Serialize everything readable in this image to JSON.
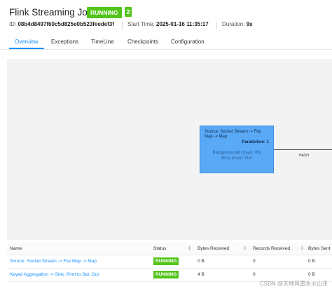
{
  "job": {
    "title": "Flink Streaming Job",
    "status": "RUNNING",
    "count": "2",
    "id_label": "ID:",
    "id_value": "08b4d8497f60c5d825e0b523feedef3f",
    "start_label": "Start Time:",
    "start_value": "2025-01-16 11:35:17",
    "duration_label": "Duration:",
    "duration_value": "9s"
  },
  "tabs": [
    "Overview",
    "Exceptions",
    "TimeLine",
    "Checkpoints",
    "Configuration"
  ],
  "active_tab": "Overview",
  "graph": {
    "node": {
      "name": "Source: Socket Stream -> Flat Map -> Map",
      "parallelism": "Parallelism: 1",
      "backpressured": "Backpressured (max): 0%",
      "busy": "Busy (max): N/A"
    },
    "edge_label": "HASH"
  },
  "table": {
    "more_indicator": "...",
    "headers": [
      "Name",
      "Status",
      "Bytes Received",
      "Records Received",
      "Bytes Sent"
    ],
    "rows": [
      {
        "name": "Source: Socket Stream -> Flat Map -> Map",
        "status": "RUNNING",
        "bytes_received": "0 B",
        "records_received": "0",
        "bytes_sent": "0 B"
      },
      {
        "name": "Keyed Aggregation -> Sink: Print to Std. Out",
        "status": "RUNNING",
        "bytes_received": "4 B",
        "records_received": "0",
        "bytes_sent": "0 B"
      }
    ]
  },
  "watermark": "CSDN @天地风雷水火山泽",
  "colors": {
    "accent": "#1890ff",
    "running": "#52c41a",
    "node": "#5aa9f7"
  }
}
